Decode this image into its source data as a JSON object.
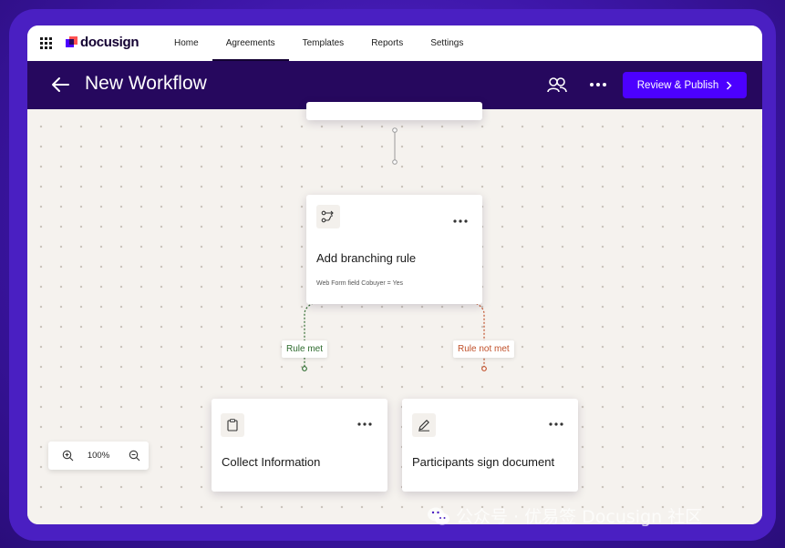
{
  "nav": {
    "brand": "docusign",
    "tabs": [
      {
        "label": "Home"
      },
      {
        "label": "Agreements"
      },
      {
        "label": "Templates"
      },
      {
        "label": "Reports"
      },
      {
        "label": "Settings"
      }
    ],
    "active_tab": "Agreements"
  },
  "header": {
    "title": "New Workflow",
    "publish_label": "Review & Publish"
  },
  "workflow": {
    "branch_card": {
      "title": "Add branching rule",
      "condition": "Web Form field  Cobuyer = Yes",
      "icon": "branch-icon"
    },
    "rule_met_label": "Rule met",
    "rule_not_met_label": "Rule not met",
    "collect_card": {
      "title": "Collect Information",
      "icon": "clipboard-icon"
    },
    "sign_card": {
      "title": "Participants sign document",
      "icon": "pen-icon"
    }
  },
  "zoom": {
    "level": "100%"
  },
  "watermark": {
    "text": "公众号 · 优易签 Docusign 社区"
  },
  "colors": {
    "accent": "#4c00ff",
    "header_bg": "#26085e",
    "rule_met": "#2e6b2e",
    "rule_not_met": "#c0502a"
  }
}
